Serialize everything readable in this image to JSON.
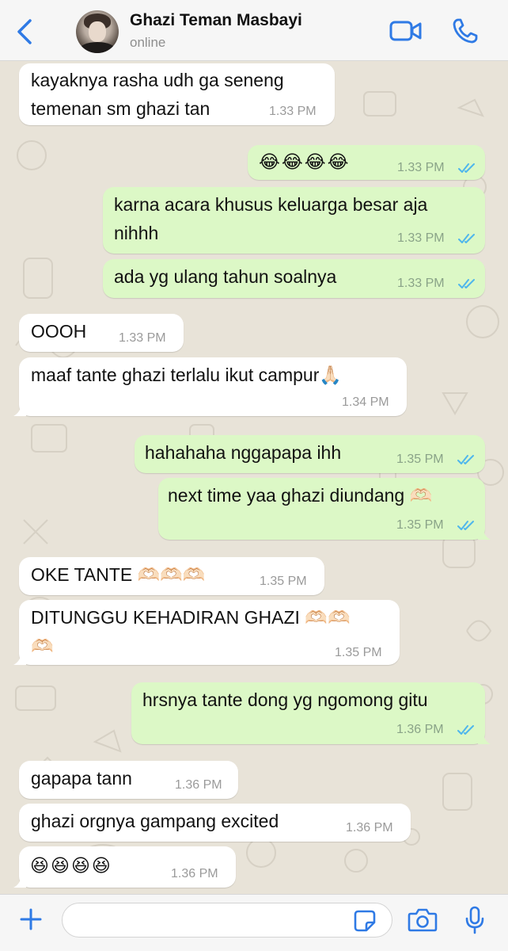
{
  "header": {
    "contact_name": "Ghazi Teman Masbayi",
    "status": "online"
  },
  "colors": {
    "accent": "#2f7ae5",
    "incoming_bubble": "#ffffff",
    "outgoing_bubble": "#dcf8c6",
    "read_ticks": "#4fb6ec"
  },
  "messages": [
    {
      "dir": "in",
      "text": "kayaknya rasha udh ga seneng\ntemenan sm ghazi tan",
      "time": "1.33 PM"
    },
    {
      "dir": "out",
      "text": "😂😂😂😂",
      "time": "1.33 PM",
      "read": true
    },
    {
      "dir": "out",
      "text": "karna acara khusus keluarga besar aja\nnihhh",
      "time": "1.33 PM",
      "read": true
    },
    {
      "dir": "out",
      "text": "ada yg ulang tahun soalnya",
      "time": "1.33 PM",
      "read": true
    },
    {
      "dir": "in",
      "text": "OOOH",
      "time": "1.33 PM"
    },
    {
      "dir": "in",
      "text": "maaf tante ghazi terlalu ikut campur🙏🏻",
      "time": "1.34 PM"
    },
    {
      "dir": "out",
      "text": "hahahaha nggapapa ihh",
      "time": "1.35 PM",
      "read": true
    },
    {
      "dir": "out",
      "text": "next time yaa ghazi diundang 🫶🏻",
      "time": "1.35 PM",
      "read": true
    },
    {
      "dir": "in",
      "text": "OKE TANTE 🫶🏻🫶🏻🫶🏻",
      "time": "1.35 PM"
    },
    {
      "dir": "in",
      "text": "DITUNGGU KEHADIRAN GHAZI 🫶🏻🫶🏻\n🫶🏻",
      "time": "1.35 PM"
    },
    {
      "dir": "out",
      "text": "hrsnya tante dong yg ngomong gitu",
      "time": "1.36 PM",
      "read": true
    },
    {
      "dir": "in",
      "text": "gapapa tann",
      "time": "1.36 PM"
    },
    {
      "dir": "in",
      "text": "ghazi orgnya gampang excited",
      "time": "1.36 PM"
    },
    {
      "dir": "in",
      "text": "😆😆😆😆",
      "time": "1.36 PM"
    }
  ],
  "icons": {
    "back": "chevron-left-icon",
    "video": "video-camera-icon",
    "call": "phone-icon",
    "attach": "plus-icon",
    "sticker": "sticker-icon",
    "camera": "camera-icon",
    "mic": "microphone-icon"
  }
}
